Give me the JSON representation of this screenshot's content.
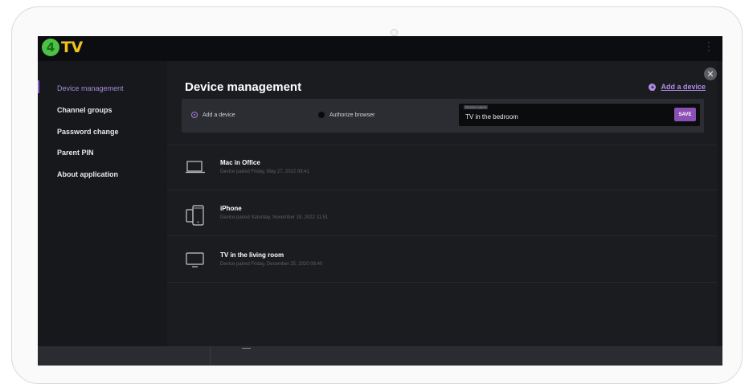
{
  "app": {
    "logo_badge": "4",
    "logo_text": "TV",
    "menu_icon": "kebab-menu-icon"
  },
  "sidebar": {
    "items": [
      {
        "label": "Device management",
        "active": true
      },
      {
        "label": "Channel groups",
        "active": false
      },
      {
        "label": "Password change",
        "active": false
      },
      {
        "label": "Parent PIN",
        "active": false
      },
      {
        "label": "About application",
        "active": false
      }
    ]
  },
  "main": {
    "title": "Device management",
    "add_device_label": "Add a device",
    "close_icon": "close-icon",
    "form": {
      "option_add": "Add a device",
      "option_authorize": "Authorize browser",
      "selected_option": "Add a device",
      "field_label": "Device name",
      "field_value": "TV in the bedroom",
      "save_label": "SAVE"
    },
    "devices": [
      {
        "name": "Mac in Office",
        "paired": "Device paired Friday, May 27, 2022 08:41",
        "icon": "laptop-icon"
      },
      {
        "name": "iPhone",
        "paired": "Device paired Saturday, November 19, 2022 11:51",
        "icon": "mobile-devices-icon"
      },
      {
        "name": "TV in the living room",
        "paired": "Device paired Friday, December 25, 2020 08:40",
        "icon": "tv-icon"
      }
    ]
  },
  "colors": {
    "accent": "#a58cd8",
    "save_button": "#8a50b5",
    "background": "#1a1c20",
    "logo_green": "#4cc245",
    "logo_yellow": "#f0c21c"
  }
}
